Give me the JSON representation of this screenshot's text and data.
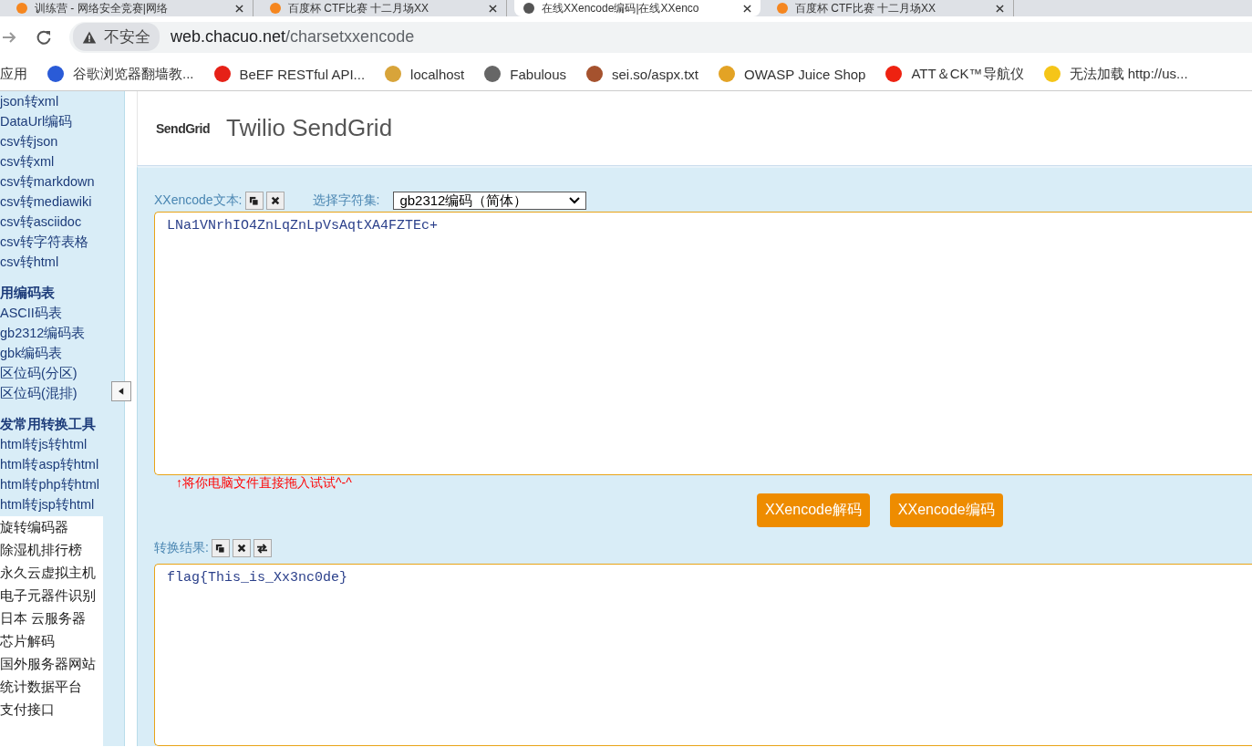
{
  "browser": {
    "tabs": [
      {
        "title": "训练营 - 网络安全竞赛|网络",
        "selected": false
      },
      {
        "title": "百度杯 CTF比赛 十二月场XX",
        "selected": false
      },
      {
        "title": "在线XXencode编码|在线XXenco",
        "selected": true
      },
      {
        "title": "百度杯 CTF比赛 十二月场XX",
        "selected": false
      }
    ],
    "security": "不安全",
    "url_host": "web.chacuo.net",
    "url_path": "/charsetxxencode",
    "bookmarks": [
      "应用",
      "谷歌浏览器翻墙教...",
      "BeEF RESTful API...",
      "localhost",
      "Fabulous",
      "sei.so/aspx.txt",
      "OWASP Juice Shop",
      "ATT＆CK™导航仪",
      "无法加载 http://us..."
    ]
  },
  "sidebar": {
    "groups": [
      {
        "items": [
          "json转xml",
          "DataUrl编码",
          "csv转json",
          "csv转xml",
          "csv转markdown",
          "csv转mediawiki",
          "csv转asciidoc",
          "csv转字符表格",
          "csv转html"
        ]
      },
      {
        "heading": "用编码表",
        "items": [
          "ASCII码表",
          "gb2312编码表",
          "gbk编码表",
          "区位码(分区)",
          "区位码(混排)"
        ]
      },
      {
        "heading": "发常用转换工具",
        "items": [
          "html转js转html",
          "html转asp转html",
          "html转php转html",
          "html转jsp转html"
        ]
      }
    ],
    "ads": [
      "旋转编码器",
      "除湿机排行榜",
      "永久云虚拟主机",
      "电子元器件识别",
      "日本  云服务器",
      "芯片解码",
      "国外服务器网站",
      "统计数据平台",
      "支付接口"
    ]
  },
  "ad_banner": {
    "logo": "SendGrid",
    "title": "Twilio SendGrid"
  },
  "tool": {
    "input_label": "XXencode文本:",
    "charset_label": "选择字符集:",
    "charset": "gb2312编码（简体）",
    "input_text": "LNa1VNrhIO4ZnLqZnLpVsAqtXA4FZTEc+",
    "hint": "↑将你电脑文件直接拖入试试^-^",
    "buttons": [
      "XXencode解码",
      "XXencode编码"
    ],
    "result_label": "转换结果:",
    "result_text": "flag{This_is_Xx3nc0de}"
  }
}
